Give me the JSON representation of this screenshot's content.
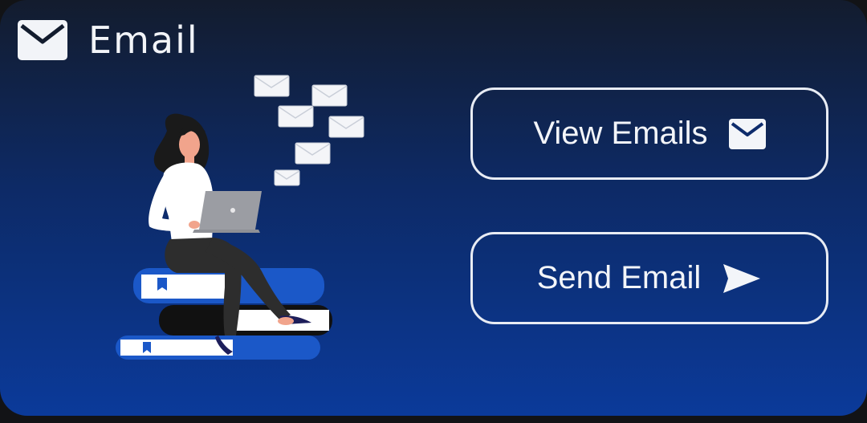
{
  "header": {
    "title": "Email",
    "icon": "mail-icon"
  },
  "actions": {
    "view_label": "View Emails",
    "view_icon": "mail-icon",
    "send_label": "Send Email",
    "send_icon": "send-arrow-icon"
  },
  "colors": {
    "card_top": "#131c2e",
    "card_bottom": "#0b3a9a",
    "foreground": "#f2f4f8",
    "book_blue": "#1b58c8"
  }
}
